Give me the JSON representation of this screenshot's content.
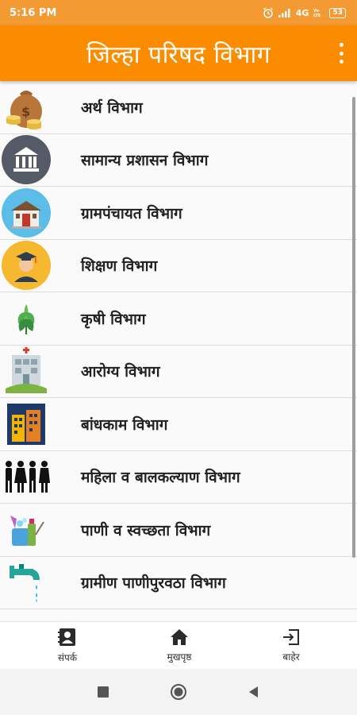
{
  "status_bar": {
    "time": "5:16 PM",
    "network": "4G",
    "battery": "53"
  },
  "header": {
    "title": "जिल्हा परिषद विभाग"
  },
  "departments": [
    {
      "label": "अर्थ विभाग",
      "icon": "money-bag-icon"
    },
    {
      "label": "सामान्य प्रशासन विभाग",
      "icon": "bank-building-icon"
    },
    {
      "label": "ग्रामपंचायत विभाग",
      "icon": "village-office-icon"
    },
    {
      "label": "शिक्षण विभाग",
      "icon": "graduate-icon"
    },
    {
      "label": "कृषी विभाग",
      "icon": "plant-icon"
    },
    {
      "label": "आरोग्य विभाग",
      "icon": "hospital-icon"
    },
    {
      "label": "बांधकाम विभाग",
      "icon": "buildings-icon"
    },
    {
      "label": "महिला व बालकल्याण विभाग",
      "icon": "family-icon"
    },
    {
      "label": "पाणी व स्वच्छता विभाग",
      "icon": "cleaning-supplies-icon"
    },
    {
      "label": "ग्रामीण पाणीपुरवठा विभाग",
      "icon": "water-tap-icon"
    }
  ],
  "bottom_nav": {
    "contact": "संपर्क",
    "home": "मुखपृष्ठ",
    "exit": "बाहेर"
  },
  "colors": {
    "status_bar": "#f39a33",
    "app_bar": "#fb8c00"
  }
}
